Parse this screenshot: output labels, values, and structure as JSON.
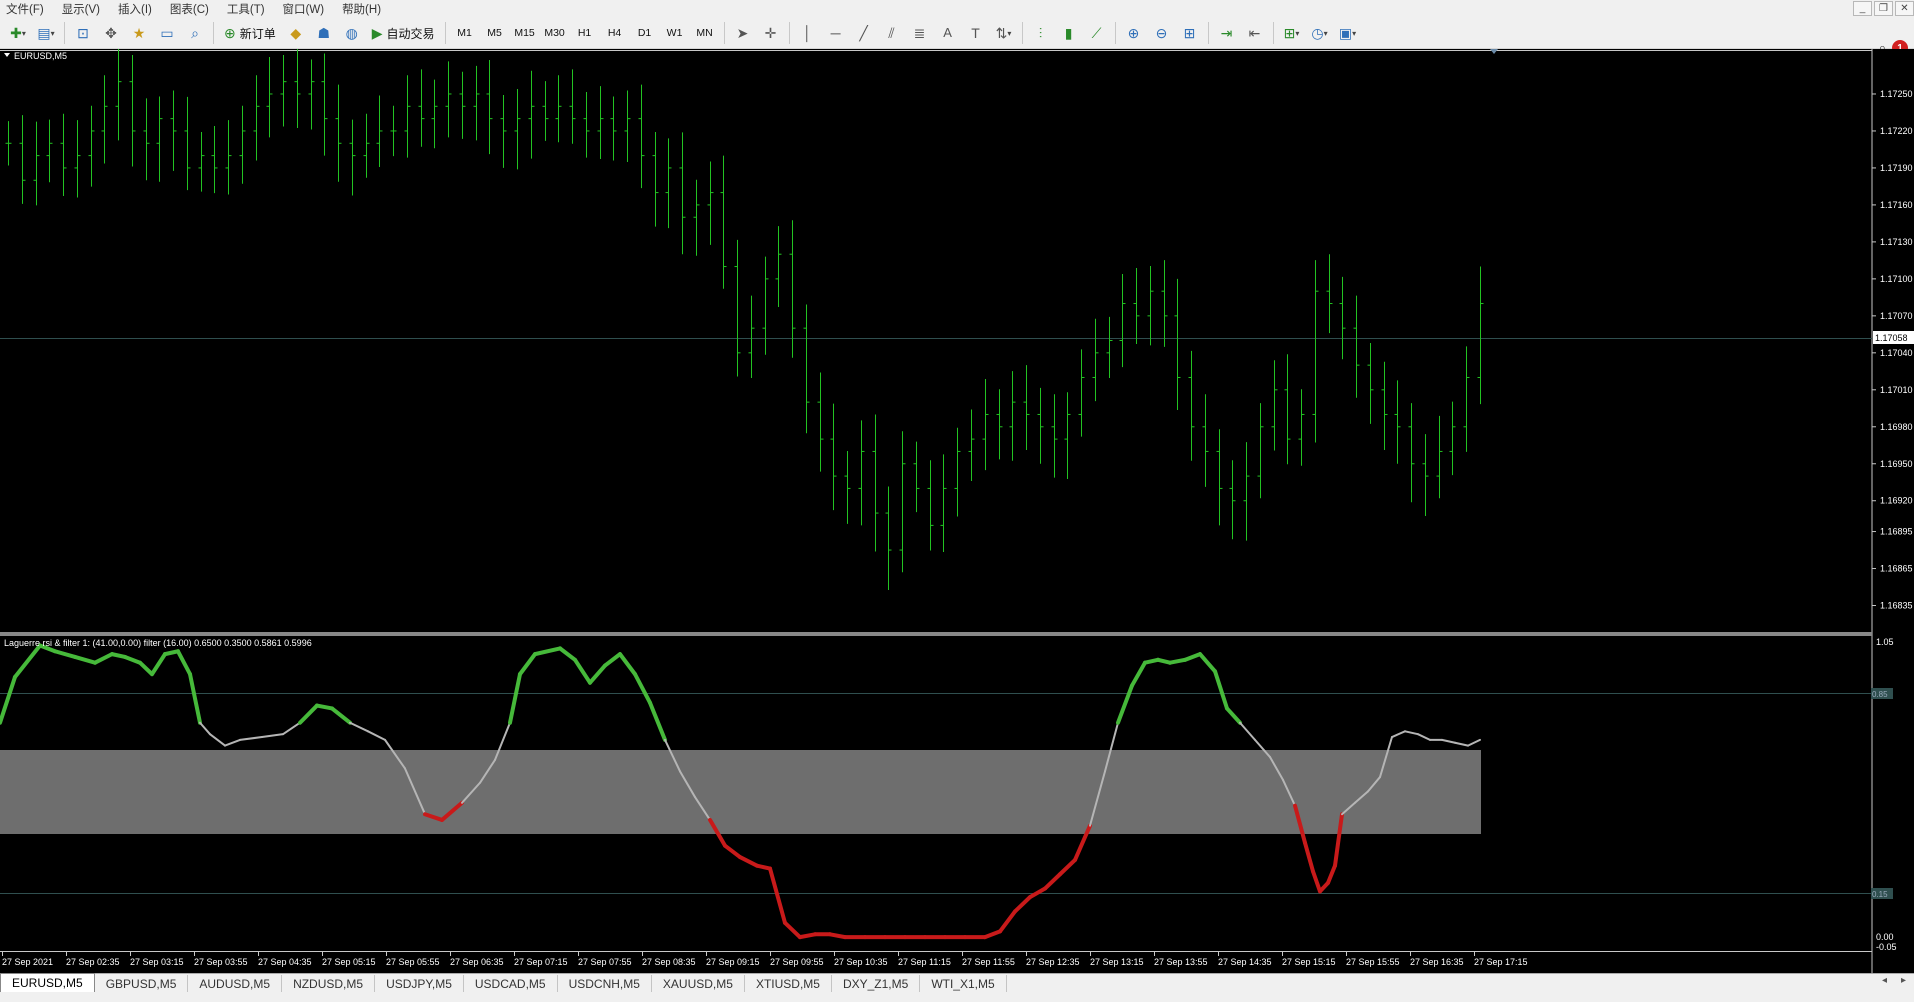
{
  "menu": [
    "文件(F)",
    "显示(V)",
    "插入(I)",
    "图表(C)",
    "工具(T)",
    "窗口(W)",
    "帮助(H)"
  ],
  "toolbar": {
    "new_order": "新订单",
    "auto_trade": "自动交易",
    "timeframes": [
      "M1",
      "M5",
      "M15",
      "M30",
      "H1",
      "H4",
      "D1",
      "W1",
      "MN"
    ],
    "notification_count": "1"
  },
  "main_chart": {
    "title": "EURUSD,M5",
    "current_price": "1.17058",
    "price_levels": [
      "1.17250",
      "1.17220",
      "1.17190",
      "1.17160",
      "1.17130",
      "1.17100",
      "1.17070",
      "1.17040",
      "1.17010",
      "1.16980",
      "1.16950",
      "1.16920",
      "1.16895",
      "1.16865",
      "1.16835"
    ]
  },
  "indicator": {
    "title": "Laguerre rsi & filter 1: (41.00,0.00) filter (16.00) 0.6500 0.3500 0.5861 0.5996",
    "levels": [
      "1.05",
      "0.85",
      "0.15",
      "0.00",
      "-0.05"
    ]
  },
  "time_labels": [
    "27 Sep 2021",
    "27 Sep 02:35",
    "27 Sep 03:15",
    "27 Sep 03:55",
    "27 Sep 04:35",
    "27 Sep 05:15",
    "27 Sep 05:55",
    "27 Sep 06:35",
    "27 Sep 07:15",
    "27 Sep 07:55",
    "27 Sep 08:35",
    "27 Sep 09:15",
    "27 Sep 09:55",
    "27 Sep 10:35",
    "27 Sep 11:15",
    "27 Sep 11:55",
    "27 Sep 12:35",
    "27 Sep 13:15",
    "27 Sep 13:55",
    "27 Sep 14:35",
    "27 Sep 15:15",
    "27 Sep 15:55",
    "27 Sep 16:35",
    "27 Sep 17:15"
  ],
  "chart_tabs": [
    "EURUSD,M5",
    "GBPUSD,M5",
    "AUDUSD,M5",
    "NZDUSD,M5",
    "USDJPY,M5",
    "USDCAD,M5",
    "USDCNH,M5",
    "XAUUSD,M5",
    "XTIUSD,M5",
    "DXY_Z1,M5",
    "WTI_X1,M5"
  ],
  "colors": {
    "bar": "#22c322",
    "grid": "#2f4f4f",
    "rsi_up": "#46b93a",
    "rsi_down": "#c81a1a",
    "rsi_neutral": "#b5b5b5",
    "band": "#6e6e6e"
  },
  "chart_data": {
    "type": "ohlc-bar",
    "symbol": "EURUSD",
    "timeframe": "M5",
    "ylim": [
      1.1682,
      1.1728
    ],
    "close": [
      1.1721,
      1.1718,
      1.172,
      1.1721,
      1.1719,
      1.172,
      1.1722,
      1.1724,
      1.1726,
      1.1722,
      1.1721,
      1.1723,
      1.1722,
      1.1719,
      1.172,
      1.1719,
      1.172,
      1.1722,
      1.1724,
      1.1725,
      1.1726,
      1.1725,
      1.1726,
      1.1723,
      1.1721,
      1.172,
      1.1721,
      1.1722,
      1.1722,
      1.1724,
      1.1723,
      1.1724,
      1.1725,
      1.1724,
      1.1725,
      1.1723,
      1.1722,
      1.1723,
      1.1724,
      1.1723,
      1.1724,
      1.1723,
      1.1722,
      1.1723,
      1.1722,
      1.1723,
      1.172,
      1.1717,
      1.1719,
      1.1715,
      1.1716,
      1.1717,
      1.1711,
      1.1704,
      1.1706,
      1.171,
      1.1712,
      1.1706,
      1.17,
      1.1697,
      1.1694,
      1.1693,
      1.1696,
      1.1691,
      1.1688,
      1.1695,
      1.1693,
      1.169,
      1.1693,
      1.1696,
      1.1697,
      1.1699,
      1.1698,
      1.17,
      1.1699,
      1.1698,
      1.1697,
      1.1699,
      1.1702,
      1.1704,
      1.1705,
      1.1708,
      1.1707,
      1.1709,
      1.1707,
      1.1702,
      1.1698,
      1.1696,
      1.1693,
      1.1692,
      1.1694,
      1.1698,
      1.1701,
      1.1697,
      1.1699,
      1.1709,
      1.1708,
      1.1706,
      1.1703,
      1.1701,
      1.1699,
      1.1698,
      1.1695,
      1.1694,
      1.1696,
      1.1698,
      1.1702,
      1.1708
    ]
  }
}
